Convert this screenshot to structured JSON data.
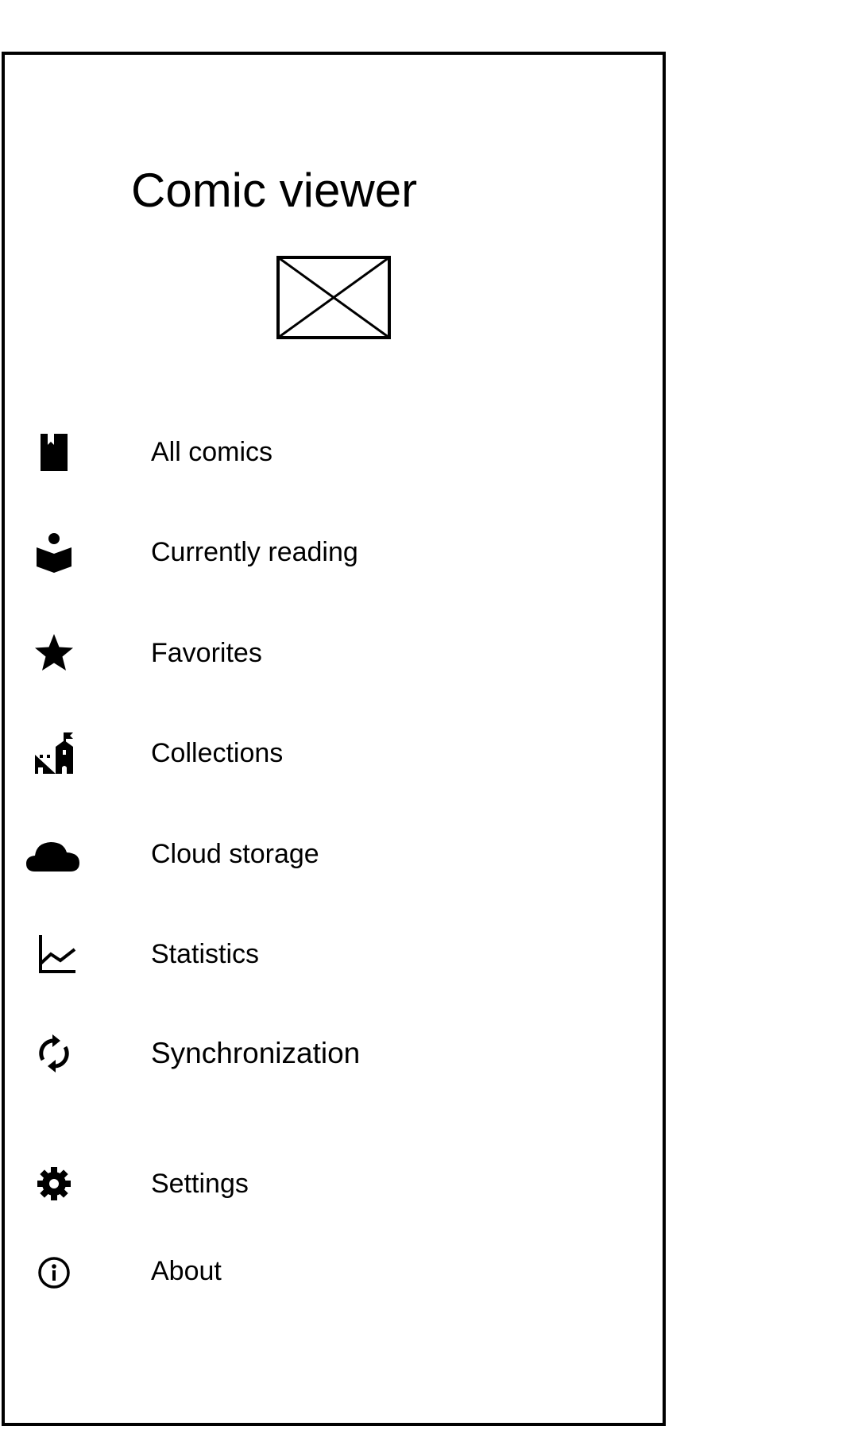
{
  "drawer": {
    "title": "Comic viewer",
    "logo_icon": "image-placeholder-icon",
    "items": [
      {
        "id": "all-comics",
        "label": "All comics",
        "icon": "bookmark-book-icon"
      },
      {
        "id": "currently-reading",
        "label": "Currently reading",
        "icon": "reader-icon"
      },
      {
        "id": "favorites",
        "label": "Favorites",
        "icon": "star-icon"
      },
      {
        "id": "collections",
        "label": "Collections",
        "icon": "castle-icon"
      },
      {
        "id": "cloud-storage",
        "label": "Cloud storage",
        "icon": "cloud-icon"
      },
      {
        "id": "statistics",
        "label": "Statistics",
        "icon": "line-chart-icon"
      },
      {
        "id": "synchronization",
        "label": "Synchronization",
        "icon": "sync-icon"
      }
    ],
    "footer_items": [
      {
        "id": "settings",
        "label": "Settings",
        "icon": "gear-icon"
      },
      {
        "id": "about",
        "label": "About",
        "icon": "info-icon"
      }
    ]
  },
  "colors": {
    "foreground": "#000000",
    "background": "#ffffff"
  }
}
